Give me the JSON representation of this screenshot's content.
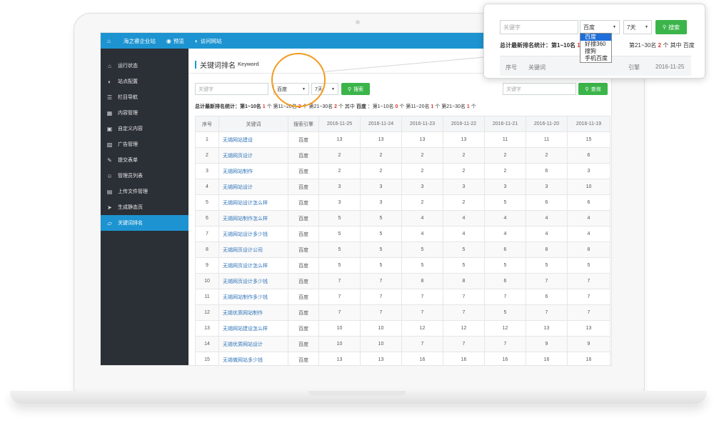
{
  "topbar": {
    "home_icon": "home-icon",
    "site_name": "海之睿企业站",
    "preview": "预览",
    "visit": "访问网站"
  },
  "sidebar": {
    "items": [
      {
        "label": "运行状态",
        "icon": "home-icon"
      },
      {
        "label": "站点配置",
        "icon": "globe-icon"
      },
      {
        "label": "栏目导航",
        "icon": "list-icon"
      },
      {
        "label": "内容管理",
        "icon": "table-icon"
      },
      {
        "label": "自定义内容",
        "icon": "window-icon"
      },
      {
        "label": "广告管理",
        "icon": "image-icon"
      },
      {
        "label": "提交表单",
        "icon": "edit-icon"
      },
      {
        "label": "管理员列表",
        "icon": "users-icon"
      },
      {
        "label": "上传文件管理",
        "icon": "files-icon"
      },
      {
        "label": "生成静态页",
        "icon": "rocket-icon"
      },
      {
        "label": "关键词排名",
        "icon": "cart-icon",
        "active": true
      }
    ]
  },
  "main": {
    "title": "关键词排名",
    "subtitle": "Keyword",
    "keyword_placeholder": "关键字",
    "engine_select": "百度",
    "days_select": "7天",
    "search_button": "搜索",
    "query_placeholder": "关键字",
    "query_button": "查询",
    "stats": {
      "p1": "总计最新排名统计：第1~10名",
      "n1": "1",
      "p2": "个 第11~20名",
      "n2": "2",
      "p3": "个 第21~30名",
      "n3": "2",
      "p4": "个 其中",
      "engine": "百度",
      "p5": "：第1~10名",
      "n4": "0",
      "p6": "个 第11~20名",
      "n5": "1",
      "p7": "个 第21~30名",
      "n6": "1",
      "p8": "个"
    },
    "columns": [
      "序号",
      "关键词",
      "搜索引擎",
      "2016-11-25",
      "2016-11-24",
      "2016-11-23",
      "2016-11-22",
      "2016-11-21",
      "2016-11-20",
      "2016-11-19"
    ],
    "rows": [
      [
        "1",
        "无锡网站建设",
        "百度",
        "13",
        "13",
        "13",
        "13",
        "11",
        "11",
        "15"
      ],
      [
        "2",
        "无锡网页设计",
        "百度",
        "2",
        "2",
        "2",
        "2",
        "2",
        "2",
        "6"
      ],
      [
        "3",
        "无锡网站制作",
        "百度",
        "2",
        "2",
        "2",
        "2",
        "2",
        "6",
        "3"
      ],
      [
        "4",
        "无锡网站设计",
        "百度",
        "3",
        "3",
        "3",
        "3",
        "3",
        "3",
        "10"
      ],
      [
        "5",
        "无锡网站设计怎么样",
        "百度",
        "3",
        "3",
        "2",
        "2",
        "5",
        "6",
        "6"
      ],
      [
        "6",
        "无锡网站制作怎么样",
        "百度",
        "5",
        "5",
        "4",
        "4",
        "4",
        "4",
        "4"
      ],
      [
        "7",
        "无锡网站设计多少钱",
        "百度",
        "5",
        "5",
        "4",
        "4",
        "4",
        "4",
        "4"
      ],
      [
        "8",
        "无锡网页设计公司",
        "百度",
        "5",
        "5",
        "5",
        "5",
        "6",
        "8",
        "8"
      ],
      [
        "9",
        "无锡网页设计怎么样",
        "百度",
        "5",
        "5",
        "5",
        "5",
        "5",
        "5",
        "5"
      ],
      [
        "10",
        "无锡网页设计多少钱",
        "百度",
        "7",
        "7",
        "8",
        "8",
        "6",
        "7",
        "7"
      ],
      [
        "11",
        "无锡网站制作多少钱",
        "百度",
        "7",
        "7",
        "7",
        "7",
        "7",
        "6",
        "7"
      ],
      [
        "12",
        "无锡优质网站制作",
        "百度",
        "7",
        "7",
        "7",
        "7",
        "5",
        "7",
        "7"
      ],
      [
        "13",
        "无锡网站建设怎么样",
        "百度",
        "10",
        "10",
        "12",
        "12",
        "12",
        "13",
        "13"
      ],
      [
        "14",
        "无锡优质网站设计",
        "百度",
        "10",
        "10",
        "7",
        "7",
        "7",
        "9",
        "9"
      ],
      [
        "15",
        "无锡做网站多少钱",
        "百度",
        "13",
        "13",
        "16",
        "16",
        "16",
        "16",
        "16"
      ]
    ]
  },
  "popup": {
    "keyword_placeholder": "关键字",
    "engine_select": "百度",
    "days_select": "7天",
    "search_button": "搜索",
    "stats_left": "总计最新排名统计：第1~10名",
    "stats_n1": "1",
    "stats_right": "第21~30名",
    "stats_n2": "2",
    "stats_tail": "个 其中 百度",
    "dropdown_options": [
      "百度",
      "好搜360",
      "搜狗",
      "手机百度"
    ],
    "header_seq": "序号",
    "header_kw": "关键词",
    "header_engine_partial": "引擎",
    "header_date": "2016-11-25"
  },
  "colors": {
    "topbar": "#1d94d1",
    "sidebar": "#2b2f36",
    "accent_green": "#3bb54a",
    "highlight_orange": "#f39a1b",
    "stat_red": "#d9362b"
  }
}
